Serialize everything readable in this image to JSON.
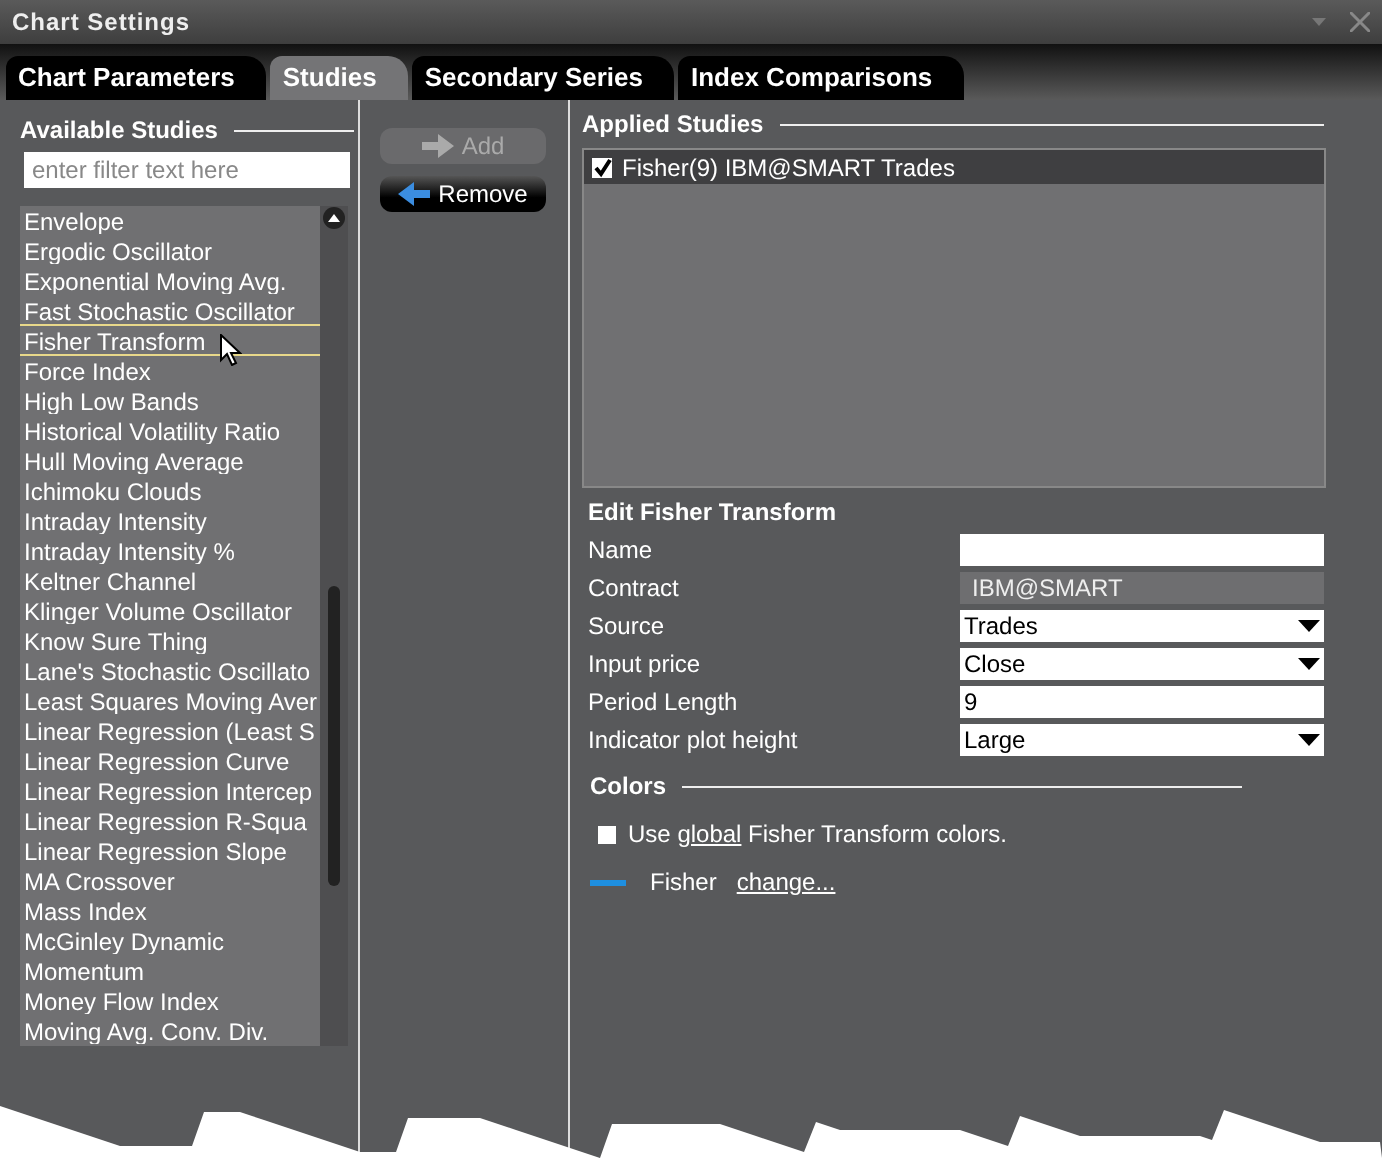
{
  "window": {
    "title": "Chart Settings"
  },
  "tabs": [
    {
      "label": "Chart Parameters",
      "selected": false
    },
    {
      "label": "Studies",
      "selected": true
    },
    {
      "label": "Secondary Series",
      "selected": false
    },
    {
      "label": "Index Comparisons",
      "selected": false
    }
  ],
  "available_studies": {
    "title": "Available Studies",
    "filter": {
      "placeholder": "enter filter text here"
    },
    "items": [
      {
        "label": "Envelope",
        "selected": false
      },
      {
        "label": "Ergodic Oscillator",
        "selected": false
      },
      {
        "label": "Exponential Moving Avg.",
        "selected": false
      },
      {
        "label": "Fast Stochastic Oscillator",
        "selected": false
      },
      {
        "label": "Fisher Transform",
        "selected": true
      },
      {
        "label": "Force Index",
        "selected": false
      },
      {
        "label": "High Low Bands",
        "selected": false
      },
      {
        "label": "Historical Volatility Ratio",
        "selected": false
      },
      {
        "label": "Hull Moving Average",
        "selected": false
      },
      {
        "label": "Ichimoku Clouds",
        "selected": false
      },
      {
        "label": "Intraday Intensity",
        "selected": false
      },
      {
        "label": "Intraday Intensity %",
        "selected": false
      },
      {
        "label": "Keltner Channel",
        "selected": false
      },
      {
        "label": "Klinger Volume Oscillator",
        "selected": false
      },
      {
        "label": "Know Sure Thing",
        "selected": false
      },
      {
        "label": "Lane's Stochastic Oscillato",
        "selected": false
      },
      {
        "label": "Least Squares Moving Aver",
        "selected": false
      },
      {
        "label": "Linear Regression (Least S",
        "selected": false
      },
      {
        "label": "Linear Regression Curve",
        "selected": false
      },
      {
        "label": "Linear Regression Intercep",
        "selected": false
      },
      {
        "label": "Linear Regression R-Squa",
        "selected": false
      },
      {
        "label": "Linear Regression Slope",
        "selected": false
      },
      {
        "label": "MA Crossover",
        "selected": false
      },
      {
        "label": "Mass Index",
        "selected": false
      },
      {
        "label": "McGinley Dynamic",
        "selected": false
      },
      {
        "label": "Momentum",
        "selected": false
      },
      {
        "label": "Money Flow Index",
        "selected": false
      },
      {
        "label": "Moving Avg. Conv. Div.",
        "selected": false
      }
    ]
  },
  "buttons": [
    {
      "label": "Add",
      "kind": "add",
      "disabled": true
    },
    {
      "label": "Remove",
      "kind": "remove",
      "disabled": false
    }
  ],
  "applied_studies": {
    "title": "Applied Studies",
    "items": [
      {
        "label": "Fisher(9) IBM@SMART Trades",
        "checked": true,
        "selected": true
      }
    ]
  },
  "edit": {
    "title": "Edit Fisher Transform",
    "fields": [
      {
        "label": "Name",
        "kind": "text"
      },
      {
        "label": "Contract",
        "kind": "readonly",
        "value": "IBM@SMART"
      },
      {
        "label": "Source",
        "kind": "select",
        "value": "Trades"
      },
      {
        "label": "Input price",
        "kind": "select",
        "value": "Close"
      },
      {
        "label": "Period Length",
        "kind": "text",
        "value": "9"
      },
      {
        "label": "Indicator plot height",
        "kind": "select",
        "value": "Large"
      }
    ]
  },
  "colors": {
    "title": "Colors",
    "use_global": {
      "checked": false,
      "before": "Use",
      "link": "global",
      "after": "Fisher Transform colors."
    },
    "series": [
      {
        "name": "Fisher",
        "color": "#1e8fe0",
        "link": "change..."
      }
    ]
  }
}
